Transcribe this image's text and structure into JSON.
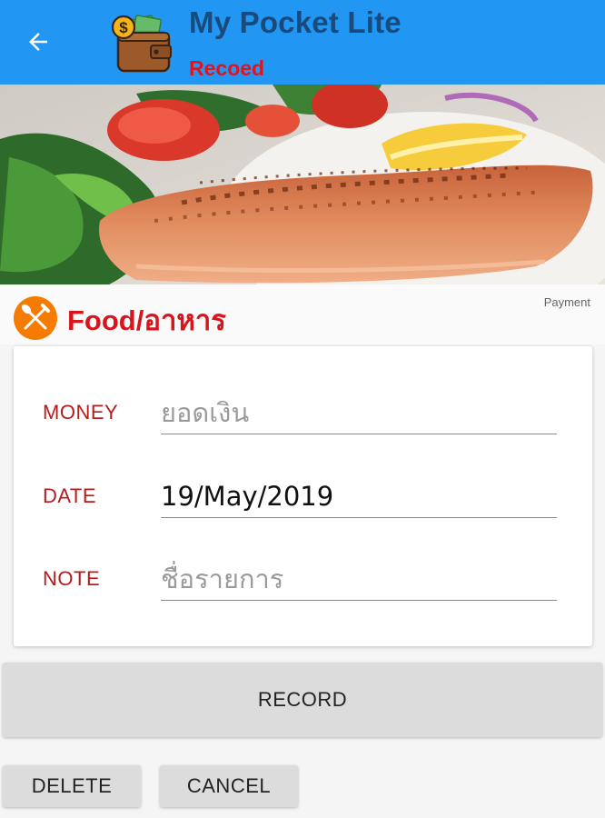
{
  "app_bar": {
    "title": "My Pocket Lite",
    "subtitle": "Recoed",
    "background_color": "#2196f3",
    "back_icon": "arrow-back-icon",
    "logo_icon": "wallet-icon"
  },
  "hero": {
    "image": "grilled salmon with salad"
  },
  "category": {
    "name": "Food/อาหาร",
    "icon": "fork-knife-icon",
    "icon_color": "#f57c00",
    "type_label": "Payment"
  },
  "form": {
    "money": {
      "label": "MONEY",
      "value": "",
      "placeholder": "ยอดเงิน"
    },
    "date": {
      "label": "DATE",
      "value": "19/May/2019",
      "placeholder": ""
    },
    "note": {
      "label": "NOTE",
      "value": "",
      "placeholder": "ชื่อรายการ"
    }
  },
  "buttons": {
    "record": "RECORD",
    "delete": "DELETE",
    "cancel": "CANCEL"
  }
}
